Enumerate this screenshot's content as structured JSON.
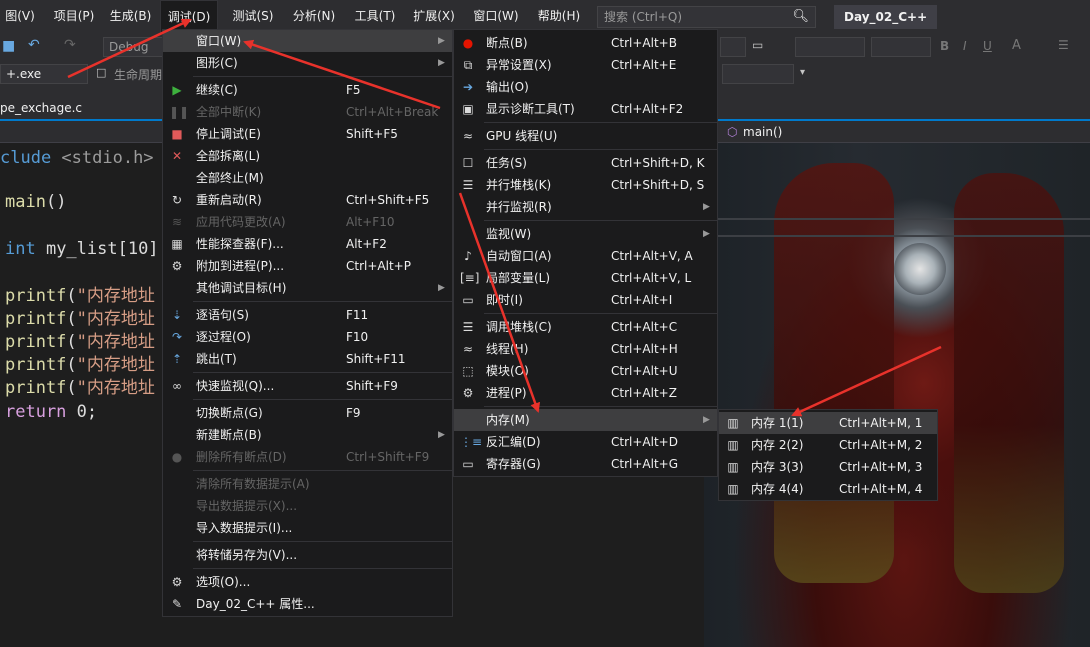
{
  "menubar": {
    "items": [
      "图(V)",
      "项目(P)",
      "生成(B)",
      "调试(D)",
      "测试(S)",
      "分析(N)",
      "工具(T)",
      "扩展(X)",
      "窗口(W)",
      "帮助(H)"
    ],
    "search_placeholder": "搜索 (Ctrl+Q)",
    "project_title": "Day_02_C++"
  },
  "toolbar": {
    "config": "Debug",
    "target": "+.exe",
    "lifecycle": "生命周期"
  },
  "tab": {
    "file_name": "pe_exchage.c",
    "nav_function": "main()"
  },
  "code": {
    "lines": [
      {
        "parts": [
          {
            "t": "clude ",
            "c": "kw"
          },
          {
            "t": "<stdio.h>",
            "c": "inc"
          }
        ]
      },
      {
        "parts": [
          {
            "t": "main",
            "c": "fn"
          },
          {
            "t": "()",
            "c": "pl"
          }
        ]
      },
      {
        "parts": [
          {
            "t": "int",
            "c": "kw"
          },
          {
            "t": " my_list[10] =",
            "c": "pl"
          }
        ]
      },
      {
        "parts": [
          {
            "t": "printf",
            "c": "fn"
          },
          {
            "t": "(",
            "c": "pl"
          },
          {
            "t": "\"内存地址",
            "c": "str"
          }
        ]
      },
      {
        "parts": [
          {
            "t": "printf",
            "c": "fn"
          },
          {
            "t": "(",
            "c": "pl"
          },
          {
            "t": "\"内存地址",
            "c": "str"
          }
        ]
      },
      {
        "parts": [
          {
            "t": "printf",
            "c": "fn"
          },
          {
            "t": "(",
            "c": "pl"
          },
          {
            "t": "\"内存地址",
            "c": "str"
          }
        ]
      },
      {
        "parts": [
          {
            "t": "printf",
            "c": "fn"
          },
          {
            "t": "(",
            "c": "pl"
          },
          {
            "t": "\"内存地址",
            "c": "str"
          }
        ]
      },
      {
        "parts": [
          {
            "t": "printf",
            "c": "fn"
          },
          {
            "t": "(",
            "c": "pl"
          },
          {
            "t": "\"内存地址",
            "c": "str"
          }
        ]
      },
      {
        "parts": [
          {
            "t": "return",
            "c": "ctl"
          },
          {
            "t": " 0;",
            "c": "pl"
          }
        ]
      }
    ]
  },
  "debug_menu": {
    "items": [
      {
        "label": "窗口(W)",
        "shortcut": "",
        "icon": "",
        "submenu": true,
        "disabled": false,
        "highlight": true
      },
      {
        "label": "图形(C)",
        "shortcut": "",
        "icon": "",
        "submenu": true,
        "disabled": false
      },
      {
        "sep": true
      },
      {
        "label": "继续(C)",
        "shortcut": "F5",
        "icon": "play-icon",
        "disabled": false
      },
      {
        "label": "全部中断(K)",
        "shortcut": "Ctrl+Alt+Break",
        "icon": "pause-icon",
        "disabled": true
      },
      {
        "label": "停止调试(E)",
        "shortcut": "Shift+F5",
        "icon": "stop-icon",
        "disabled": false
      },
      {
        "label": "全部拆离(L)",
        "shortcut": "",
        "icon": "close-icon",
        "disabled": false
      },
      {
        "label": "全部终止(M)",
        "shortcut": "",
        "icon": "",
        "disabled": false
      },
      {
        "label": "重新启动(R)",
        "shortcut": "Ctrl+Shift+F5",
        "icon": "restart-icon",
        "disabled": false
      },
      {
        "label": "应用代码更改(A)",
        "shortcut": "Alt+F10",
        "icon": "apply-changes-icon",
        "disabled": true
      },
      {
        "label": "性能探查器(F)...",
        "shortcut": "Alt+F2",
        "icon": "profiler-icon",
        "disabled": false
      },
      {
        "label": "附加到进程(P)...",
        "shortcut": "Ctrl+Alt+P",
        "icon": "attach-icon",
        "disabled": false
      },
      {
        "label": "其他调试目标(H)",
        "shortcut": "",
        "icon": "",
        "submenu": true,
        "disabled": false
      },
      {
        "sep": true
      },
      {
        "label": "逐语句(S)",
        "shortcut": "F11",
        "icon": "step-into-icon",
        "disabled": false
      },
      {
        "label": "逐过程(O)",
        "shortcut": "F10",
        "icon": "step-over-icon",
        "disabled": false
      },
      {
        "label": "跳出(T)",
        "shortcut": "Shift+F11",
        "icon": "step-out-icon",
        "disabled": false
      },
      {
        "sep": true
      },
      {
        "label": "快速监视(Q)...",
        "shortcut": "Shift+F9",
        "icon": "glasses-icon",
        "disabled": false
      },
      {
        "sep": true
      },
      {
        "label": "切换断点(G)",
        "shortcut": "F9",
        "icon": "",
        "disabled": false
      },
      {
        "label": "新建断点(B)",
        "shortcut": "",
        "icon": "",
        "submenu": true,
        "disabled": false
      },
      {
        "label": "删除所有断点(D)",
        "shortcut": "Ctrl+Shift+F9",
        "icon": "delete-breakpoints-icon",
        "disabled": true
      },
      {
        "sep": true
      },
      {
        "label": "清除所有数据提示(A)",
        "shortcut": "",
        "icon": "",
        "disabled": true
      },
      {
        "label": "导出数据提示(X)...",
        "shortcut": "",
        "icon": "",
        "disabled": true
      },
      {
        "label": "导入数据提示(I)...",
        "shortcut": "",
        "icon": "",
        "disabled": false
      },
      {
        "sep": true
      },
      {
        "label": "将转储另存为(V)...",
        "shortcut": "",
        "icon": "",
        "disabled": false
      },
      {
        "sep": true
      },
      {
        "label": "选项(O)...",
        "shortcut": "",
        "icon": "gear-icon",
        "disabled": false
      },
      {
        "label": "Day_02_C++ 属性...",
        "shortcut": "",
        "icon": "wrench-icon",
        "disabled": false
      }
    ]
  },
  "window_menu": {
    "items": [
      {
        "label": "断点(B)",
        "shortcut": "Ctrl+Alt+B",
        "icon": "breakpoint-icon"
      },
      {
        "label": "异常设置(X)",
        "shortcut": "Ctrl+Alt+E",
        "icon": "exception-settings-icon"
      },
      {
        "label": "输出(O)",
        "shortcut": "",
        "icon": "output-icon"
      },
      {
        "label": "显示诊断工具(T)",
        "shortcut": "Ctrl+Alt+F2",
        "icon": "diagnostics-icon"
      },
      {
        "sep": true
      },
      {
        "label": "GPU 线程(U)",
        "shortcut": "",
        "icon": "gpu-threads-icon"
      },
      {
        "sep": true
      },
      {
        "label": "任务(S)",
        "shortcut": "Ctrl+Shift+D, K",
        "icon": "tasks-icon"
      },
      {
        "label": "并行堆栈(K)",
        "shortcut": "Ctrl+Shift+D, S",
        "icon": "parallel-stacks-icon"
      },
      {
        "label": "并行监视(R)",
        "shortcut": "",
        "icon": "",
        "submenu": true
      },
      {
        "sep": true
      },
      {
        "label": "监视(W)",
        "shortcut": "",
        "icon": "",
        "submenu": true
      },
      {
        "label": "自动窗口(A)",
        "shortcut": "Ctrl+Alt+V, A",
        "icon": "autos-icon"
      },
      {
        "label": "局部变量(L)",
        "shortcut": "Ctrl+Alt+V, L",
        "icon": "locals-icon"
      },
      {
        "label": "即时(I)",
        "shortcut": "Ctrl+Alt+I",
        "icon": "immediate-icon"
      },
      {
        "sep": true
      },
      {
        "label": "调用堆栈(C)",
        "shortcut": "Ctrl+Alt+C",
        "icon": "call-stack-icon"
      },
      {
        "label": "线程(H)",
        "shortcut": "Ctrl+Alt+H",
        "icon": "threads-icon"
      },
      {
        "label": "模块(O)",
        "shortcut": "Ctrl+Alt+U",
        "icon": "modules-icon"
      },
      {
        "label": "进程(P)",
        "shortcut": "Ctrl+Alt+Z",
        "icon": "processes-icon"
      },
      {
        "sep": true
      },
      {
        "label": "内存(M)",
        "shortcut": "",
        "icon": "",
        "submenu": true,
        "highlight": true
      },
      {
        "label": "反汇编(D)",
        "shortcut": "Ctrl+Alt+D",
        "icon": "disassembly-icon"
      },
      {
        "label": "寄存器(G)",
        "shortcut": "Ctrl+Alt+G",
        "icon": "registers-icon"
      }
    ]
  },
  "memory_menu": {
    "items": [
      {
        "label": "内存 1(1)",
        "shortcut": "Ctrl+Alt+M, 1",
        "icon": "memory-chip-icon",
        "highlight": true
      },
      {
        "label": "内存 2(2)",
        "shortcut": "Ctrl+Alt+M, 2",
        "icon": "memory-chip-icon"
      },
      {
        "label": "内存 3(3)",
        "shortcut": "Ctrl+Alt+M, 3",
        "icon": "memory-chip-icon"
      },
      {
        "label": "内存 4(4)",
        "shortcut": "Ctrl+Alt+M, 4",
        "icon": "memory-chip-icon"
      }
    ]
  },
  "colors": {
    "annotation_arrow": "#e8322b",
    "accent": "#007acc",
    "menu_bg": "#1b1b1c",
    "highlight": "#3e3e40"
  }
}
